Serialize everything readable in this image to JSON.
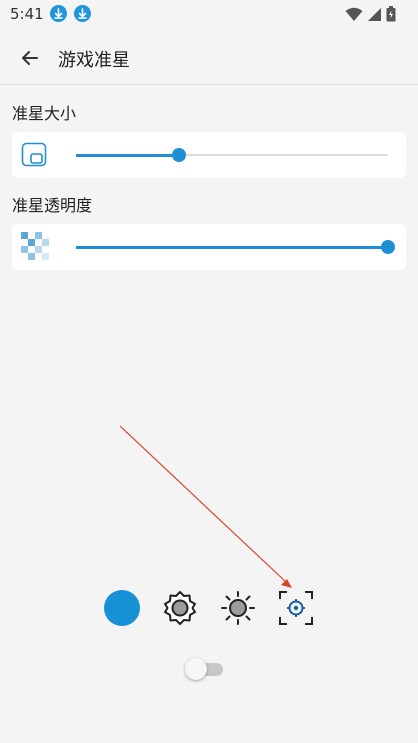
{
  "status_bar": {
    "time": "5:41",
    "left_icons": [
      "download-icon",
      "download-icon"
    ],
    "right_icons": [
      "wifi-icon",
      "signal-icon",
      "battery-icon"
    ]
  },
  "app_bar": {
    "back_icon": "arrow-left-icon",
    "title": "游戏准星"
  },
  "crosshair_size": {
    "label": "准星大小",
    "icon": "resize-icon",
    "value": 0.33
  },
  "crosshair_opacity": {
    "label": "准星透明度",
    "icon": "transparency-grid-icon",
    "value": 1.0
  },
  "controls": {
    "color_swatch": "#1791d6",
    "buttons": [
      "color-swatch",
      "settings-gear-icon",
      "brightness-icon",
      "crosshair-target-icon"
    ]
  },
  "toggle": {
    "enabled": false
  },
  "colors": {
    "accent": "#1f8fd4",
    "background": "#f4f4f4",
    "card": "#ffffff",
    "annotation_arrow": "#d9452b"
  }
}
